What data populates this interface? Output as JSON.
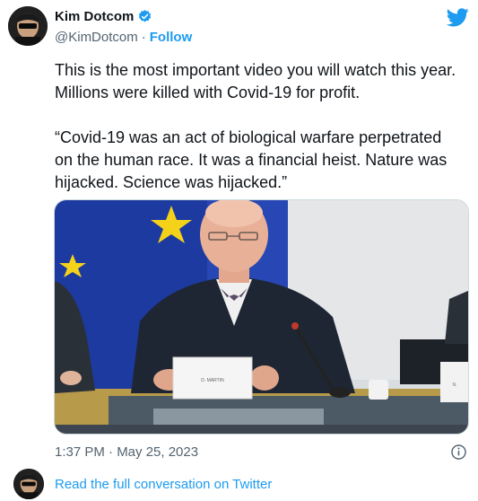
{
  "author": {
    "display_name": "Kim Dotcom",
    "handle": "@KimDotcom",
    "separator": "·",
    "follow_label": "Follow",
    "verified_icon": "verified-badge-icon",
    "brand_icon": "twitter-bird-icon"
  },
  "tweet": {
    "paragraphs": [
      "This is the most important video you will watch this year. Millions were killed with Covid-19 for profit.",
      "“Covid-19 was an act of biological warfare perpetrated on the human race. It was a financial heist. Nature was hijacked. Science was hijacked.”"
    ],
    "media": {
      "nameplate_left": "D. MARTIN",
      "nameplate_right": "N."
    },
    "timestamp": "1:37 PM · May 25, 2023",
    "info_icon": "info-icon"
  },
  "footer": {
    "link_label": "Read the full conversation on Twitter"
  },
  "colors": {
    "accent": "#1d9bf0",
    "secondary_text": "#536471",
    "primary_text": "#0f1419"
  }
}
